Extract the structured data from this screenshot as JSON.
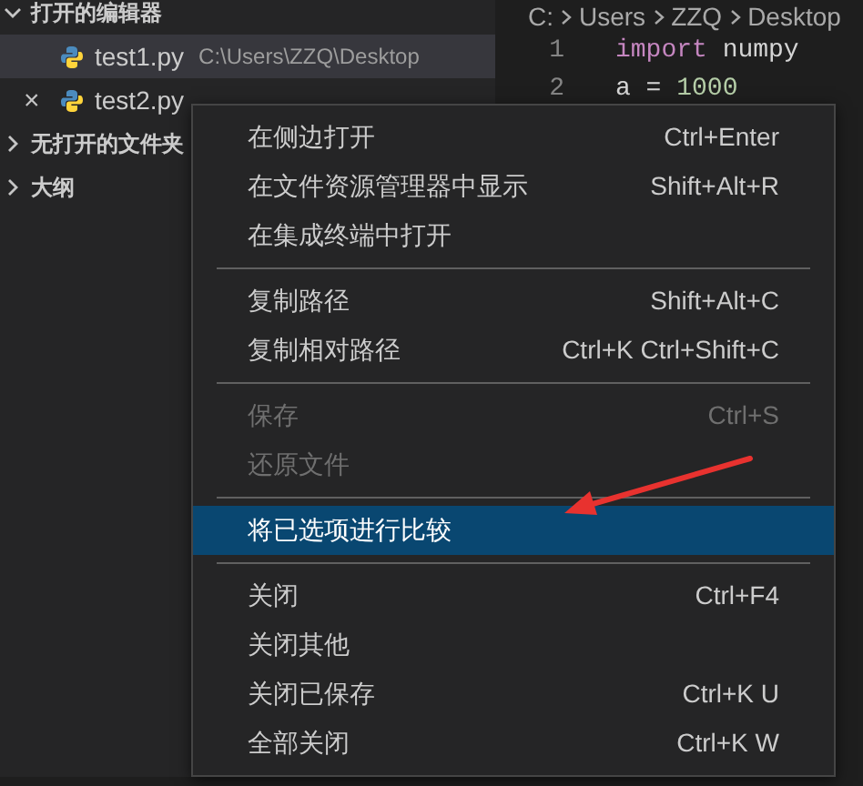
{
  "sidebar": {
    "sections": [
      {
        "title": "打开的编辑器",
        "expanded": true,
        "editors": [
          {
            "name": "test1.py",
            "path": "C:\\Users\\ZZQ\\Desktop",
            "selected": true
          },
          {
            "name": "test2.py",
            "close": "×",
            "selected": false
          }
        ]
      },
      {
        "title": "无打开的文件夹",
        "expanded": false
      },
      {
        "title": "大纲",
        "expanded": false
      }
    ]
  },
  "editor": {
    "breadcrumbs": [
      "C:",
      "Users",
      "ZZQ",
      "Desktop"
    ],
    "lines": [
      {
        "number": "1",
        "tokens": [
          {
            "text": "import",
            "kind": "keyword"
          },
          {
            "text": " numpy",
            "kind": "plain"
          }
        ]
      },
      {
        "number": "2",
        "tokens": [
          {
            "text": "a = ",
            "kind": "plain"
          },
          {
            "text": "1000",
            "kind": "number"
          }
        ]
      }
    ]
  },
  "context_menu": {
    "groups": [
      [
        {
          "label": "在侧边打开",
          "shortcut": "Ctrl+Enter",
          "disabled": false,
          "selected": false
        },
        {
          "label": "在文件资源管理器中显示",
          "shortcut": "Shift+Alt+R",
          "disabled": false,
          "selected": false
        },
        {
          "label": "在集成终端中打开",
          "disabled": false,
          "selected": false
        }
      ],
      [
        {
          "label": "复制路径",
          "shortcut": "Shift+Alt+C",
          "disabled": false,
          "selected": false
        },
        {
          "label": "复制相对路径",
          "shortcut": "Ctrl+K Ctrl+Shift+C",
          "disabled": false,
          "selected": false
        }
      ],
      [
        {
          "label": "保存",
          "shortcut": "Ctrl+S",
          "disabled": true,
          "selected": false
        },
        {
          "label": "还原文件",
          "disabled": true,
          "selected": false
        }
      ],
      [
        {
          "label": "将已选项进行比较",
          "disabled": false,
          "selected": true
        }
      ],
      [
        {
          "label": "关闭",
          "shortcut": "Ctrl+F4",
          "disabled": false,
          "selected": false
        },
        {
          "label": "关闭其他",
          "disabled": false,
          "selected": false
        },
        {
          "label": "关闭已保存",
          "shortcut": "Ctrl+K U",
          "disabled": false,
          "selected": false
        },
        {
          "label": "全部关闭",
          "shortcut": "Ctrl+K W",
          "disabled": false,
          "selected": false
        }
      ]
    ]
  }
}
